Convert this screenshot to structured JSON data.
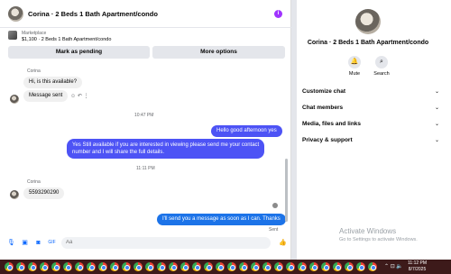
{
  "header": {
    "title": "Corina · 2 Beds 1 Bath Apartment/condo",
    "info_icon": "info-icon"
  },
  "marketplace": {
    "label": "Marketplace",
    "listing": "$1,100 · 2 Beds 1 Bath Apartment/condo"
  },
  "actions": {
    "mark_pending": "Mark as pending",
    "more_options": "More options"
  },
  "messages": {
    "sender1": "Corina",
    "m1": "Hi, is this available?",
    "m2": "Message sent",
    "time1": "10:47 PM",
    "m3": "Hello good afternoon yes",
    "m4_line1": "Yes Still available if you are interested in viewing please send me your contact",
    "m4_line2": "number and I will share the full details.",
    "time2": "11:11 PM",
    "sender2": "Corina",
    "m5": "5593290290",
    "m6": "I'll send you a message as soon as I can. Thanks",
    "status": "Sent"
  },
  "composer": {
    "placeholder": "Aa"
  },
  "side": {
    "title": "Corina · 2 Beds 1 Bath Apartment/condo",
    "mute": "Mute",
    "search": "Search",
    "rows": [
      "Customize chat",
      "Chat members",
      "Media, files and links",
      "Privacy & support"
    ]
  },
  "watermark": {
    "title": "Activate Windows",
    "sub": "Go to Settings to activate Windows."
  },
  "taskbar": {
    "time": "11:12 PM",
    "date": "8/7/2025"
  },
  "colors": {
    "outgoing_purple": "#4d53f5",
    "outgoing_blue": "#1c73e8",
    "accent": "#0866ff"
  }
}
